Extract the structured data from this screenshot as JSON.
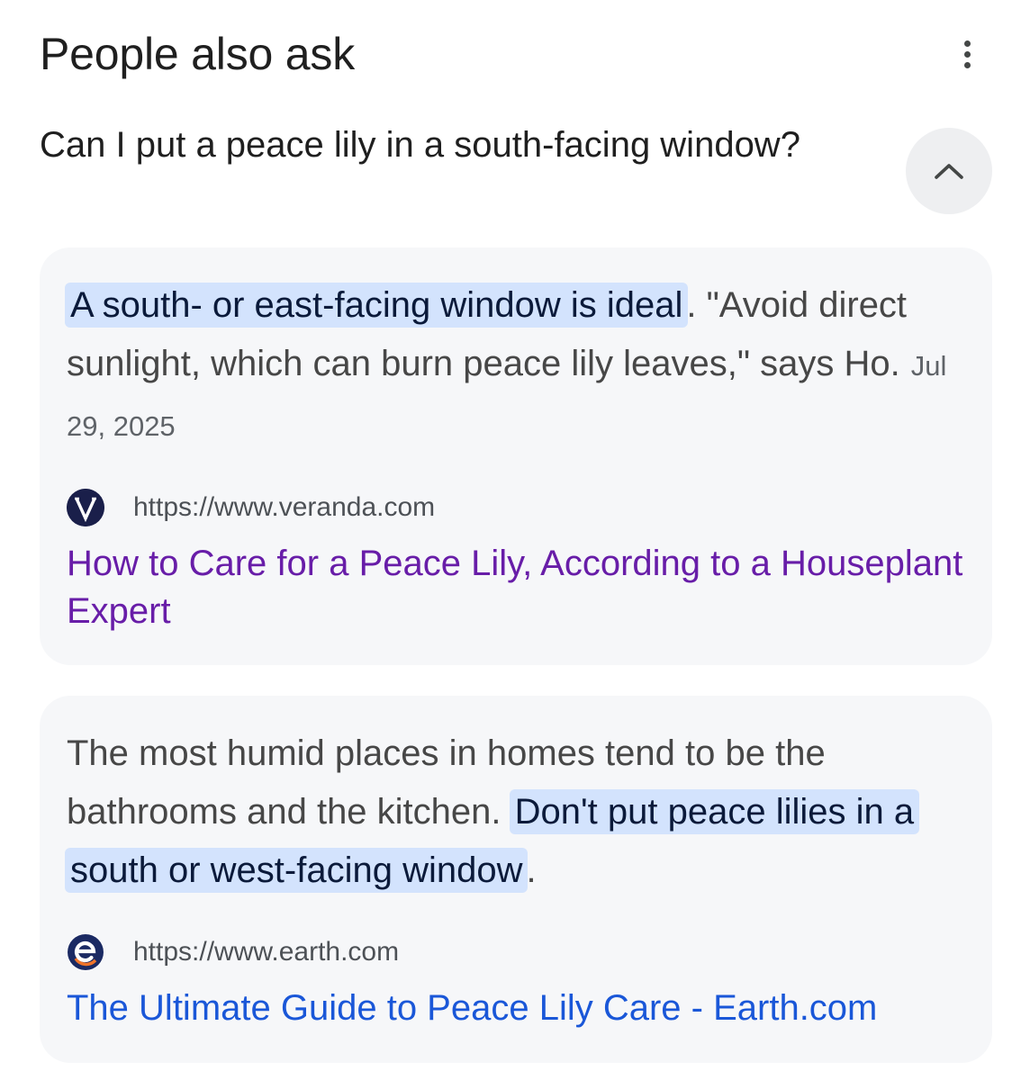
{
  "header": {
    "title": "People also ask"
  },
  "question": {
    "text": "Can I put a peace lily in a south-facing window?",
    "expanded": true
  },
  "results": [
    {
      "highlight": "A south- or east-facing window is ideal",
      "text_after": ". \"Avoid direct sunlight, which can burn peace lily leaves,\" says Ho.",
      "date": "Jul 29, 2025",
      "favicon": "veranda-v-icon",
      "url": "https://www.veranda.com",
      "link_title": "How to Care for a Peace Lily, According to a Houseplant Expert",
      "link_state": "visited"
    },
    {
      "text_before": "The most humid places in homes tend to be the bathrooms and the kitchen. ",
      "highlight": "Don't put peace lilies in a south or west-facing window",
      "text_after": ".",
      "favicon": "earth-e-icon",
      "url": "https://www.earth.com",
      "link_title": "The Ultimate Guide to Peace Lily Care - Earth.com",
      "link_state": "unvisited"
    }
  ],
  "colors": {
    "highlight_bg": "#d3e3fd",
    "card_bg": "#f6f7f9",
    "visited_link": "#681da8",
    "link": "#1a57d8"
  }
}
